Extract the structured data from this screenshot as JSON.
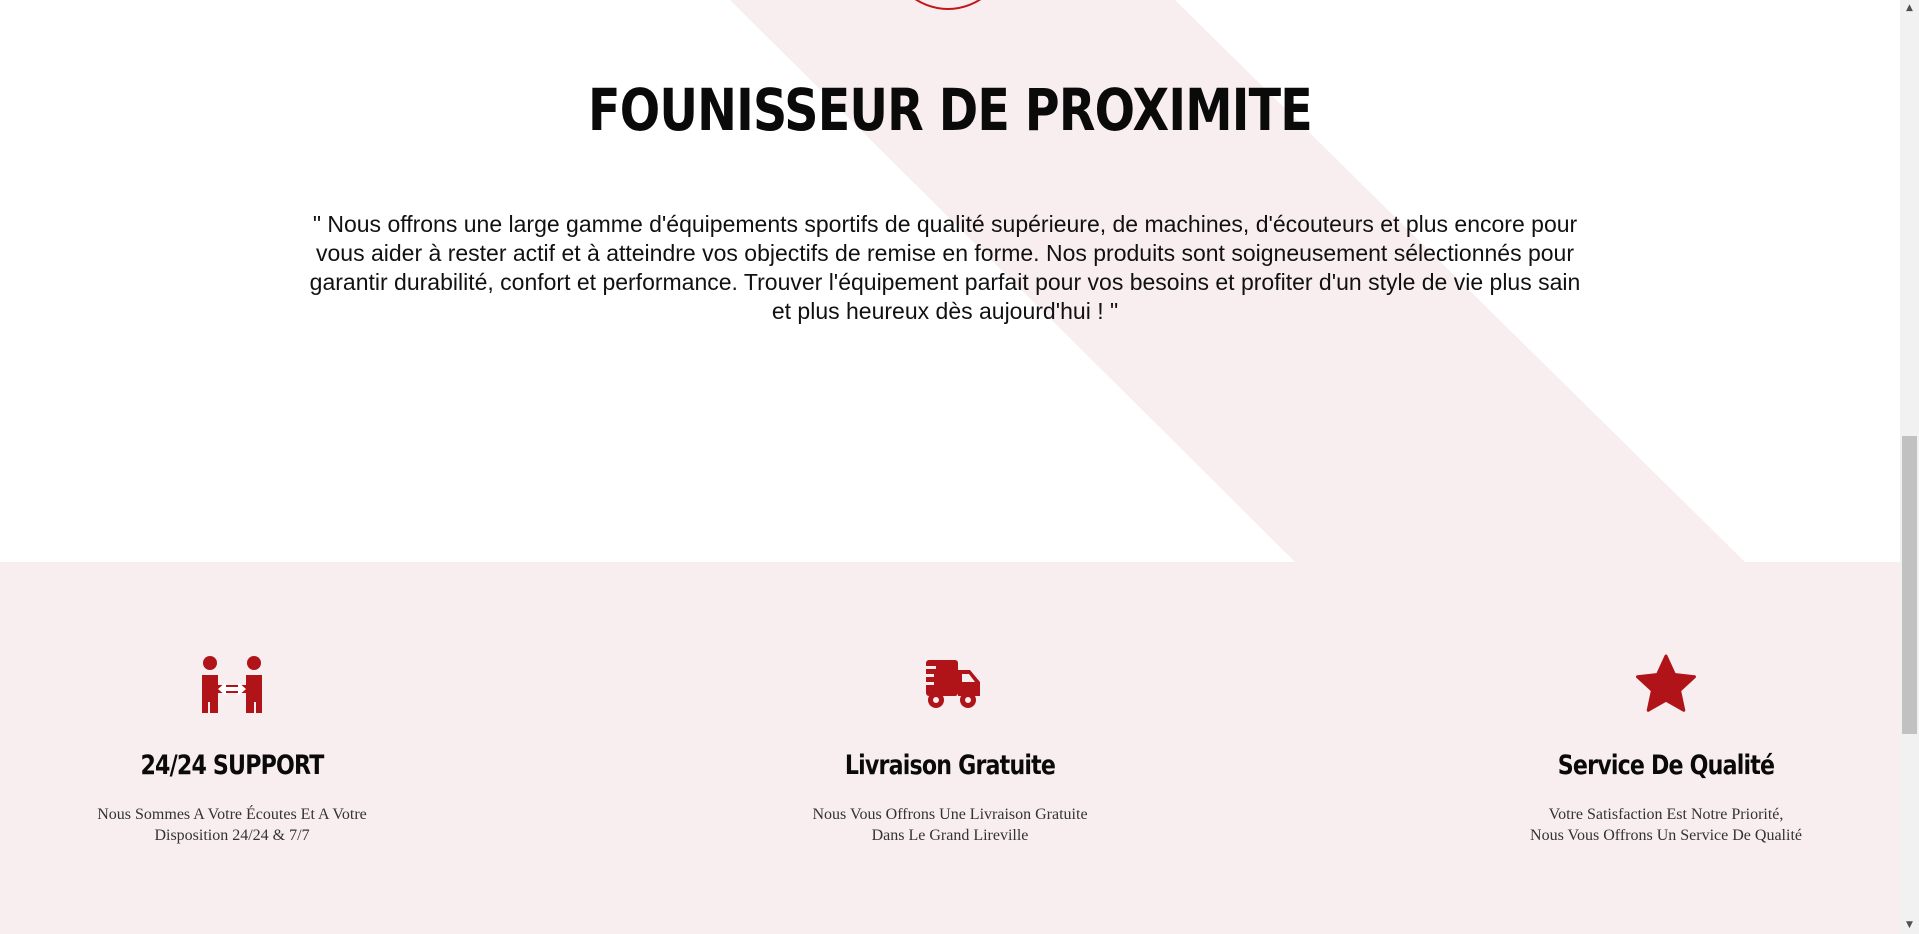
{
  "hero": {
    "title": "FOUNISSEUR DE PROXIMITE",
    "text": "\" Nous offrons une large gamme d'équipements sportifs de qualité supérieure, de machines, d'écouteurs et plus encore pour vous aider à rester actif et à atteindre vos objectifs de remise en forme. Nos produits sont soigneusement sélectionnés pour garantir durabilité, confort et performance. Trouver l'équipement parfait pour vos besoins et profiter d'un style de vie plus sain et plus heureux dès aujourd'hui ! \""
  },
  "features": [
    {
      "icon": "support-people-icon",
      "title": "24/24 SUPPORT",
      "line1": "Nous Sommes A Votre Écoutes Et A Votre",
      "line2": "Disposition 24/24 & 7/7"
    },
    {
      "icon": "delivery-truck-icon",
      "title": "Livraison Gratuite",
      "line1": "Nous Vous Offrons Une Livraison Gratuite",
      "line2": "Dans Le Grand Lireville"
    },
    {
      "icon": "star-icon",
      "title": "Service De Qualité",
      "line1": "Votre Satisfaction Est Notre Priorité,",
      "line2": "Nous Vous Offrons Un Service De Qualité"
    }
  ],
  "colors": {
    "accent": "#b01318",
    "band": "#f8eef0",
    "text": "#0a0a0a"
  },
  "scrollbar": {
    "up_arrow": "▲",
    "down_arrow": "▼"
  }
}
